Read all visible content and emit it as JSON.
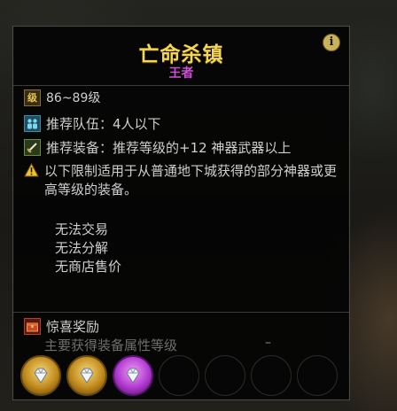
{
  "dungeon": {
    "title": "亡命杀镇",
    "difficulty": "王者",
    "level_icon_glyph": "级",
    "level_range": "86~89级",
    "party_label": "推荐队伍：4人以下",
    "gear_label": "推荐装备：推荐等级的+12 神器武器以上",
    "warning_text": "以下限制适用于从普通地下城获得的部分神器或更高等级的装备。",
    "restrictions": [
      "无法交易",
      "无法分解",
      "无商店售价"
    ]
  },
  "reward": {
    "title": "惊喜奖励",
    "subtitle": "主要获得装备属性等级",
    "value": "–"
  },
  "icons": {
    "info": "i",
    "info_name": "info-icon",
    "level_name": "level-icon",
    "party_name": "party-icon",
    "gear_name": "sword-icon",
    "warning_name": "warning-icon",
    "reward_name": "treasure-chest-icon"
  },
  "reward_slots": [
    {
      "kind": "gold",
      "icon": "diamond-gem-icon"
    },
    {
      "kind": "gold",
      "icon": "diamond-gem-icon"
    },
    {
      "kind": "purple",
      "icon": "diamond-gem-icon"
    },
    {
      "kind": "empty"
    },
    {
      "kind": "empty"
    },
    {
      "kind": "empty"
    },
    {
      "kind": "empty"
    }
  ],
  "colors": {
    "title": "#f4d64f",
    "difficulty": "#d04fd6",
    "text": "#cfcfcf",
    "subtext": "#6e6e6e"
  }
}
